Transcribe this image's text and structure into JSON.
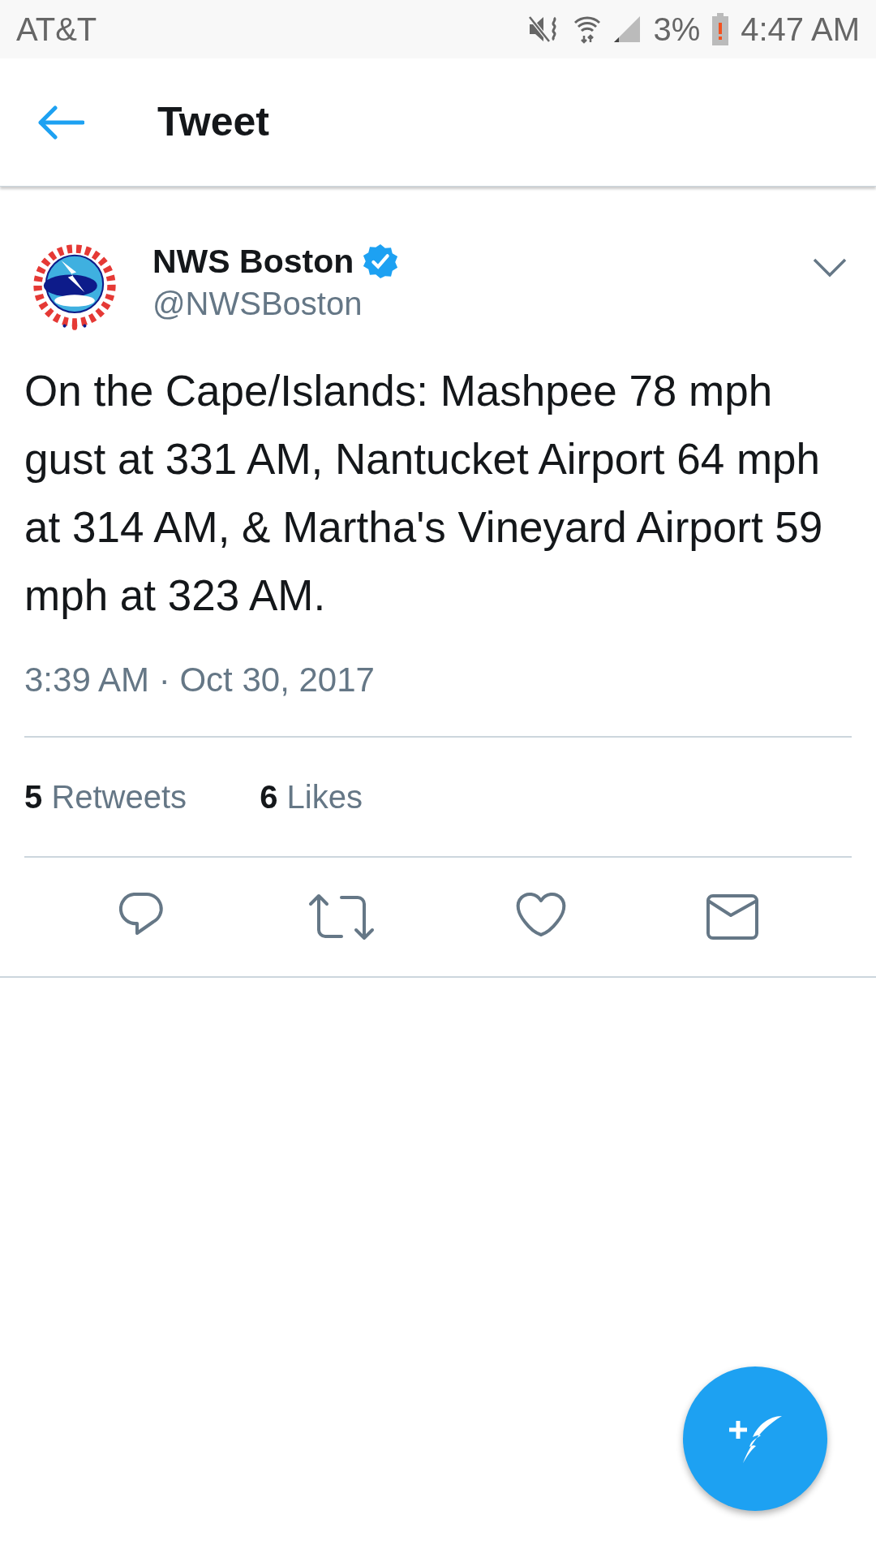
{
  "status_bar": {
    "carrier": "AT&T",
    "battery": "3%",
    "time": "4:47 AM"
  },
  "header": {
    "title": "Tweet"
  },
  "tweet": {
    "author": {
      "name": "NWS Boston",
      "verified": true,
      "handle": "@NWSBoston"
    },
    "text": "On the Cape/Islands: Mashpee 78 mph gust at 331 AM, Nantucket Airport 64 mph at 314 AM, & Martha's Vineyard Airport 59 mph at 323 AM.",
    "timestamp": "3:39 AM · Oct 30, 2017",
    "stats": [
      {
        "count": "5",
        "label": "Retweets"
      },
      {
        "count": "6",
        "label": "Likes"
      }
    ],
    "actions": [
      {
        "kind": "reply"
      },
      {
        "kind": "retweet"
      },
      {
        "kind": "like"
      },
      {
        "kind": "message"
      }
    ]
  }
}
